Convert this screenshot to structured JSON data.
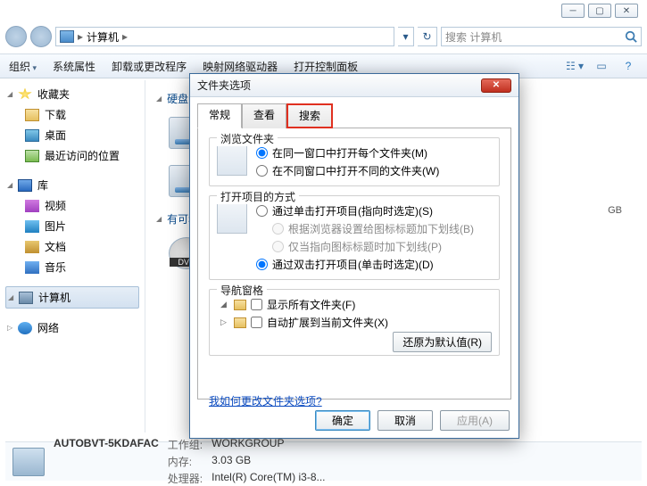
{
  "window_controls": {
    "min": "─",
    "max": "▢",
    "close": "✕"
  },
  "breadcrumb": {
    "root_icon": "computer-icon",
    "item": "计算机",
    "sep": "▸"
  },
  "search": {
    "placeholder": "搜索 计算机"
  },
  "toolbar": {
    "organize": "组织",
    "sys_props": "系统属性",
    "uninstall": "卸载或更改程序",
    "map_drive": "映射网络驱动器",
    "control_panel": "打开控制面板"
  },
  "sidebar": {
    "favorites": {
      "label": "收藏夹",
      "items": [
        "下载",
        "桌面",
        "最近访问的位置"
      ]
    },
    "libraries": {
      "label": "库",
      "items": [
        "视频",
        "图片",
        "文档",
        "音乐"
      ]
    },
    "computer": {
      "label": "计算机"
    },
    "network": {
      "label": "网络"
    }
  },
  "main": {
    "hdd_section": "硬盘 (",
    "removable_section": "有可移",
    "gb_suffix": "GB"
  },
  "statusbar": {
    "name": "AUTOBVT-5KDAFAC",
    "workgroup_lbl": "工作组:",
    "workgroup": "WORKGROUP",
    "mem_lbl": "内存:",
    "mem": "3.03 GB",
    "cpu_lbl": "处理器:",
    "cpu": "Intel(R) Core(TM) i3-8..."
  },
  "dialog": {
    "title": "文件夹选项",
    "tabs": {
      "general": "常规",
      "view": "查看",
      "search": "搜索"
    },
    "browse": {
      "legend": "浏览文件夹",
      "opt_same": "在同一窗口中打开每个文件夹(M)",
      "opt_new": "在不同窗口中打开不同的文件夹(W)"
    },
    "click": {
      "legend": "打开项目的方式",
      "opt_single": "通过单击打开项目(指向时选定)(S)",
      "sub_browser": "根据浏览器设置给图标标题加下划线(B)",
      "sub_point": "仅当指向图标标题时加下划线(P)",
      "opt_double": "通过双击打开项目(单击时选定)(D)"
    },
    "nav": {
      "legend": "导航窗格",
      "show_all": "显示所有文件夹(F)",
      "auto_expand": "自动扩展到当前文件夹(X)"
    },
    "restore": "还原为默认值(R)",
    "link": "我如何更改文件夹选项?",
    "ok": "确定",
    "cancel": "取消",
    "apply": "应用(A)"
  }
}
